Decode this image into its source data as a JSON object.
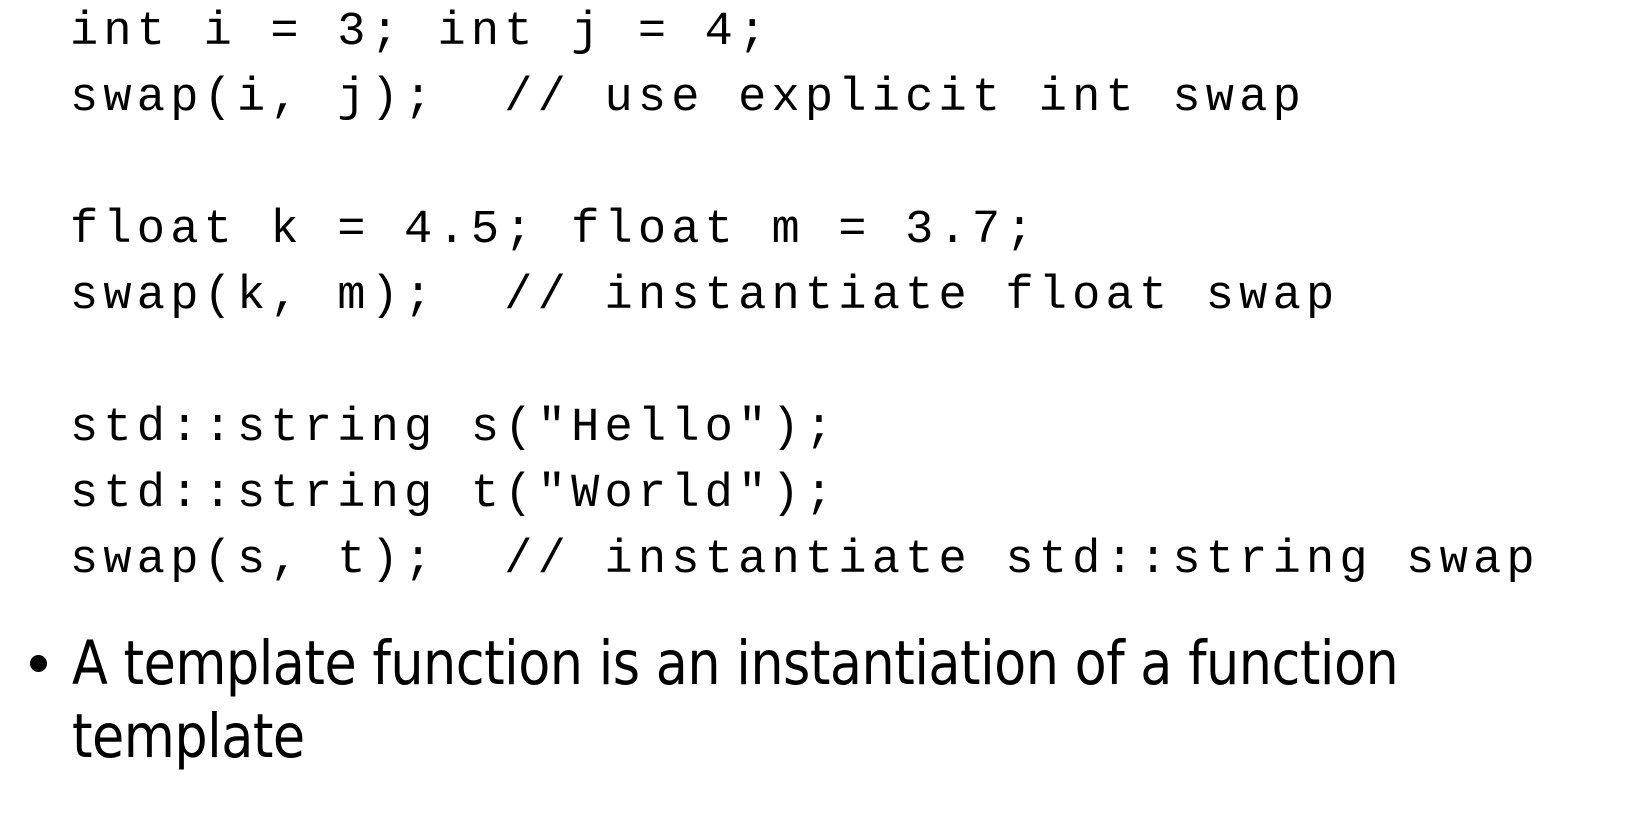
{
  "slide": {
    "background_color": "#ffffff",
    "text_color": "#000000",
    "code": {
      "lines": [
        "int i = 3; int j = 4;",
        "swap(i, j);  // use explicit int swap",
        "",
        "float k = 4.5; float m = 3.7;",
        "swap(k, m);  // instantiate float swap",
        "",
        "std::string s(\"Hello\");",
        "std::string t(\"World\");",
        "swap(s, t);  // instantiate std::string swap"
      ]
    },
    "bullets": [
      {
        "marker": "bullet-dot",
        "text": "A template function is an instantiation of a function template"
      }
    ]
  }
}
